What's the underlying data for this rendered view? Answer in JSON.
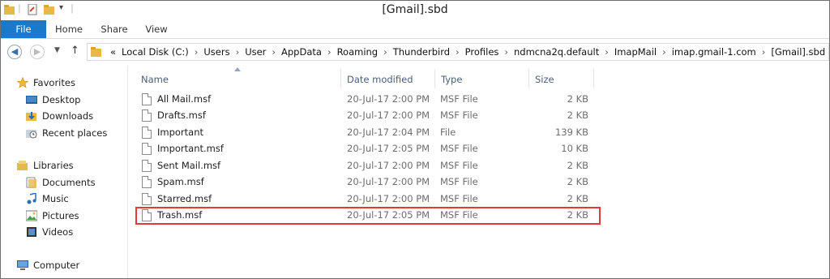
{
  "window": {
    "title": "[Gmail].sbd"
  },
  "quick_access": {
    "dropdown_glyph": "▾"
  },
  "ribbon": {
    "tabs": [
      "File",
      "Home",
      "Share",
      "View"
    ],
    "active_color": "#1979ca"
  },
  "address_bar": {
    "overflow": "«",
    "crumbs": [
      "Local Disk (C:)",
      "Users",
      "User",
      "AppData",
      "Roaming",
      "Thunderbird",
      "Profiles",
      "ndmcna2q.default",
      "ImapMail",
      "imap.gmail-1.com",
      "[Gmail].sbd"
    ],
    "separator": "›"
  },
  "nav_pane": {
    "favorites": {
      "label": "Favorites",
      "items": [
        "Desktop",
        "Downloads",
        "Recent places"
      ]
    },
    "libraries": {
      "label": "Libraries",
      "items": [
        "Documents",
        "Music",
        "Pictures",
        "Videos"
      ]
    },
    "computer": {
      "label": "Computer"
    }
  },
  "columns": {
    "name": "Name",
    "date": "Date modified",
    "type": "Type",
    "size": "Size"
  },
  "files": [
    {
      "name": "All Mail.msf",
      "date": "20-Jul-17 2:00 PM",
      "type": "MSF File",
      "size": "2 KB"
    },
    {
      "name": "Drafts.msf",
      "date": "20-Jul-17 2:00 PM",
      "type": "MSF File",
      "size": "2 KB"
    },
    {
      "name": "Important",
      "date": "20-Jul-17 2:04 PM",
      "type": "File",
      "size": "139 KB"
    },
    {
      "name": "Important.msf",
      "date": "20-Jul-17 2:05 PM",
      "type": "MSF File",
      "size": "10 KB"
    },
    {
      "name": "Sent Mail.msf",
      "date": "20-Jul-17 2:00 PM",
      "type": "MSF File",
      "size": "2 KB"
    },
    {
      "name": "Spam.msf",
      "date": "20-Jul-17 2:00 PM",
      "type": "MSF File",
      "size": "2 KB"
    },
    {
      "name": "Starred.msf",
      "date": "20-Jul-17 2:00 PM",
      "type": "MSF File",
      "size": "2 KB"
    },
    {
      "name": "Trash.msf",
      "date": "20-Jul-17 2:05 PM",
      "type": "MSF File",
      "size": "2 KB"
    }
  ],
  "highlight_color": "#e03a3a"
}
